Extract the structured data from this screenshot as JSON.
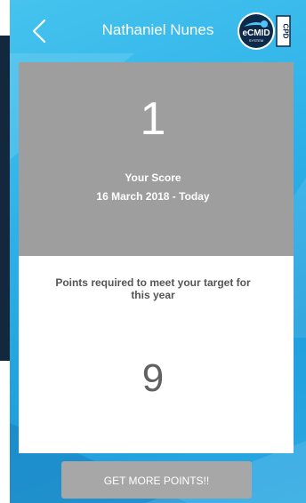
{
  "header": {
    "title": "Nathaniel Nunes",
    "back_icon": "chevron-left-icon",
    "logo": {
      "brand_text": "eCMID",
      "system_text": "SYSTEM",
      "side_text": "CPD"
    }
  },
  "score": {
    "value": "1",
    "label": "Your Score",
    "range": "16 March 2018 - Today"
  },
  "points": {
    "text": "Points required to meet your target for this year",
    "value": "9"
  },
  "cta": {
    "label": "GET MORE POINTS!!"
  },
  "colors": {
    "background": "#2fb3e9",
    "score_card": "#9e9e9e",
    "points_card": "#ffffff",
    "button": "#a7a7a7",
    "logo_dark": "#0d2a4a"
  }
}
